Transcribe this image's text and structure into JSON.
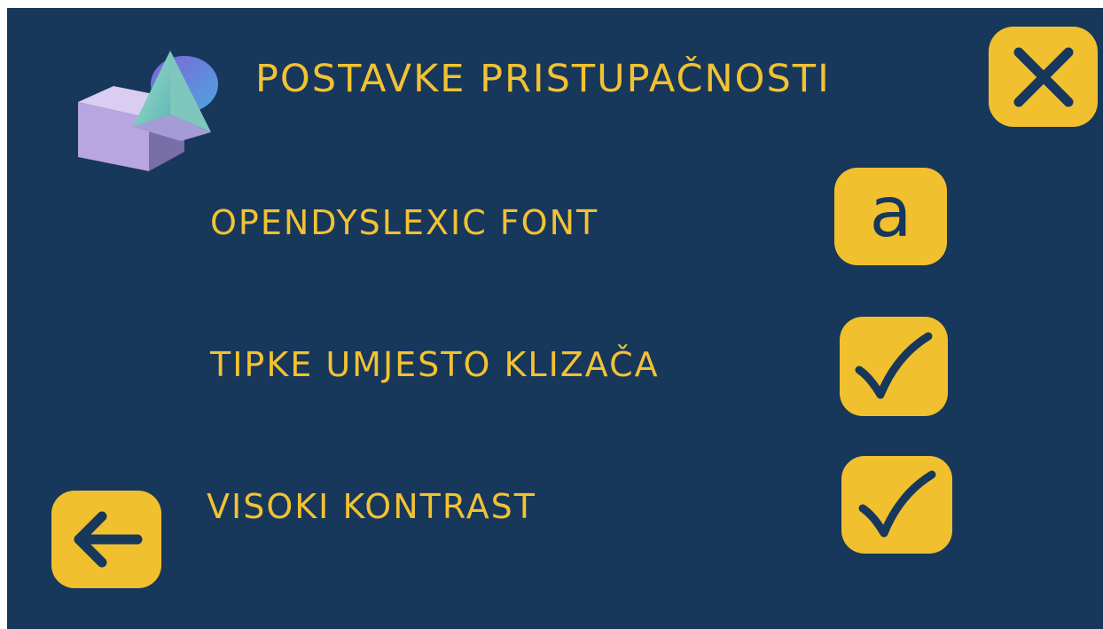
{
  "header": {
    "title": "POSTAVKE PRISTUPAČNOSTI",
    "logo_icon": "geometric-shapes-logo",
    "close_icon": "close-icon"
  },
  "settings": [
    {
      "label": "OPENDYSLEXIC FONT",
      "control_icon": "font-a-icon",
      "glyph": "a"
    },
    {
      "label": "TIPKE UMJESTO KLIZAČA",
      "control_icon": "checkmark-icon"
    },
    {
      "label": "VISOKI KONTRAST",
      "control_icon": "checkmark-icon"
    }
  ],
  "footer": {
    "back_icon": "arrow-left-icon"
  },
  "colors": {
    "background": "#17375b",
    "accent": "#f1c02e",
    "icon": "#17375b"
  }
}
